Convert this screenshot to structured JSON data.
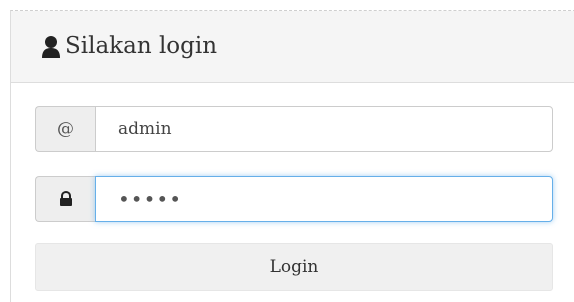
{
  "panel": {
    "title": "Silakan login",
    "title_icon": "user-icon"
  },
  "username": {
    "addon": "@",
    "value": "admin"
  },
  "password": {
    "addon_icon": "lock-icon",
    "masked_value": "•••••"
  },
  "login_button": {
    "label": "Login"
  },
  "colors": {
    "focus_border": "#66afe9",
    "heading_bg": "#f5f5f5",
    "addon_bg": "#eeeeee"
  }
}
